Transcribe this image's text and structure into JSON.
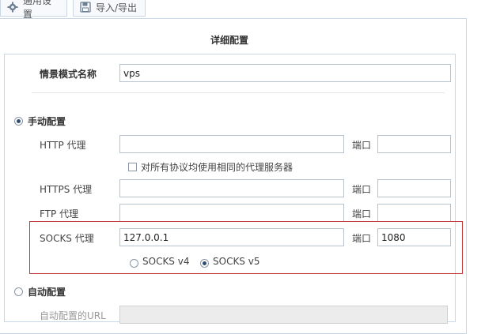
{
  "tabs": {
    "general_label": "通用设置",
    "import_label": "导入/导出"
  },
  "section_title": "详细配置",
  "profile": {
    "label": "情景模式名称",
    "value": "vps"
  },
  "manual": {
    "label": "手动配置",
    "selected": true,
    "http": {
      "label": "HTTP 代理",
      "value": "",
      "port_label": "端口",
      "port_value": ""
    },
    "same_proxy": {
      "label": "对所有协议均使用相同的代理服务器",
      "checked": false
    },
    "https": {
      "label": "HTTPS 代理",
      "value": "",
      "port_label": "端口",
      "port_value": ""
    },
    "ftp": {
      "label": "FTP 代理",
      "value": "",
      "port_label": "端口",
      "port_value": ""
    },
    "socks": {
      "label": "SOCKS 代理",
      "value": "127.0.0.1",
      "port_label": "端口",
      "port_value": "1080"
    },
    "socks_version": {
      "v4_label": "SOCKS v4",
      "v5_label": "SOCKS v5",
      "selected": "SOCKS v5"
    }
  },
  "auto": {
    "label": "自动配置",
    "selected": false,
    "url_label": "自动配置的URL"
  },
  "colors": {
    "accent": "#2f4e6e",
    "border": "#c9d6e3",
    "highlight": "#c0393b"
  }
}
